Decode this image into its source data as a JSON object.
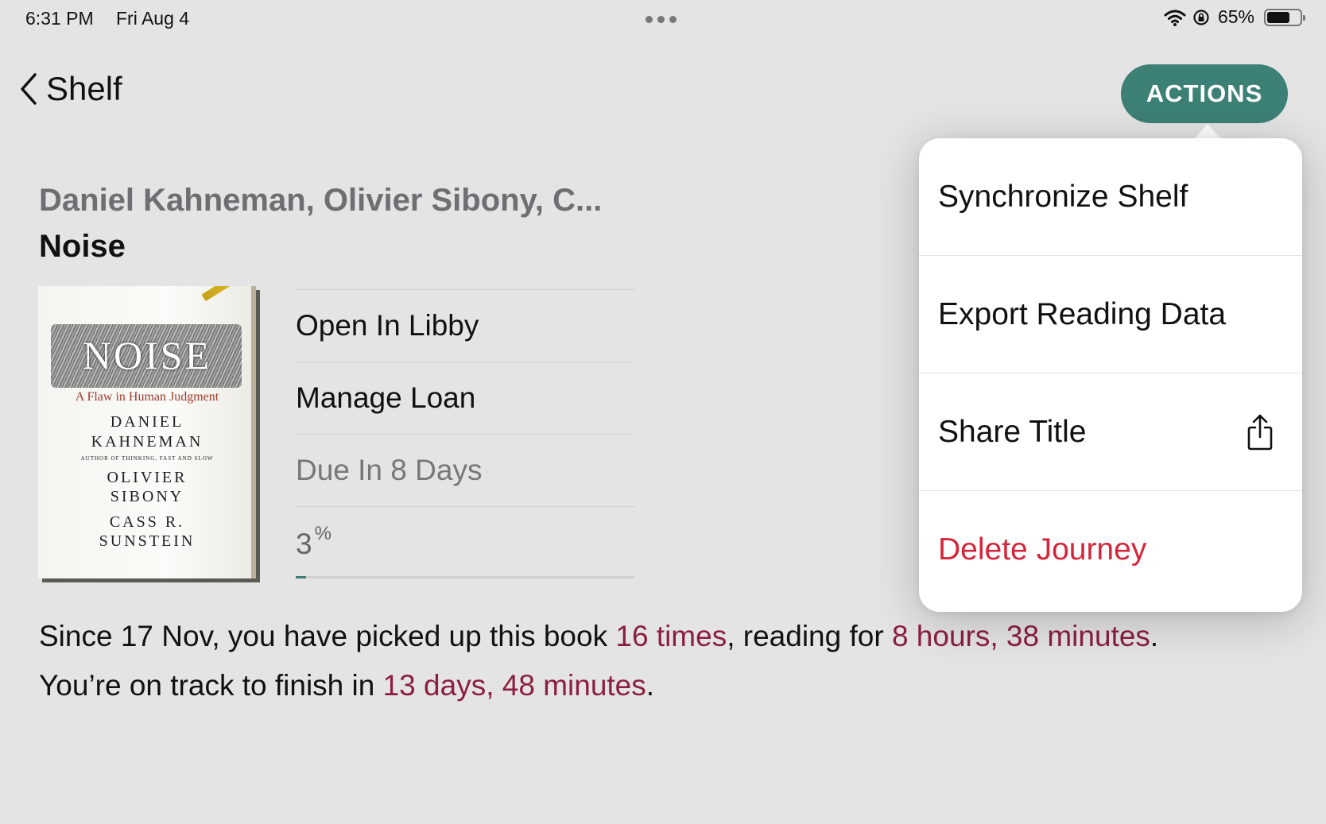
{
  "status_bar": {
    "time": "6:31 PM",
    "date": "Fri Aug 4",
    "battery_percent": "65%",
    "battery_level": 0.65,
    "icons": [
      "wifi-icon",
      "orientation-lock-icon",
      "battery-icon"
    ]
  },
  "nav": {
    "back_label": "Shelf",
    "back_icon": "chevron-left-icon",
    "actions_label": "ACTIONS",
    "accent_color": "#3d8076"
  },
  "book": {
    "authors": "Daniel Kahneman, Olivier Sibony, C...",
    "title": "Noise",
    "cover": {
      "title_word": "NOISE",
      "subtitle": "A Flaw in Human Judgment",
      "author1_first": "DANIEL",
      "author1_last": "KAHNEMAN",
      "author1_note": "AUTHOR OF THINKING, FAST AND SLOW",
      "author2_first": "OLIVIER",
      "author2_last": "SIBONY",
      "author3_first": "CASS R.",
      "author3_last": "SUNSTEIN"
    }
  },
  "menu": {
    "open_in_libby": "Open In Libby",
    "manage_loan": "Manage Loan",
    "due_in": "Due In 8 Days",
    "progress_value": "3",
    "progress_unit": "%",
    "progress_fraction": 0.03
  },
  "summary": {
    "part1": "Since 17 Nov, you have picked up this book ",
    "times": "16 times",
    "part2": ", reading for ",
    "duration": "8 hours, 38 minutes",
    "part3": ".",
    "part4": "You’re on track to finish in ",
    "finish": "13 days, 48 minutes",
    "part5": ".",
    "highlight_color": "#8c1f3f"
  },
  "popover": {
    "items": [
      {
        "label": "Synchronize Shelf"
      },
      {
        "label": "Export Reading Data"
      },
      {
        "label": "Share Title",
        "icon": "share-icon"
      },
      {
        "label": "Delete Journey",
        "color": "#d4263b"
      }
    ]
  }
}
